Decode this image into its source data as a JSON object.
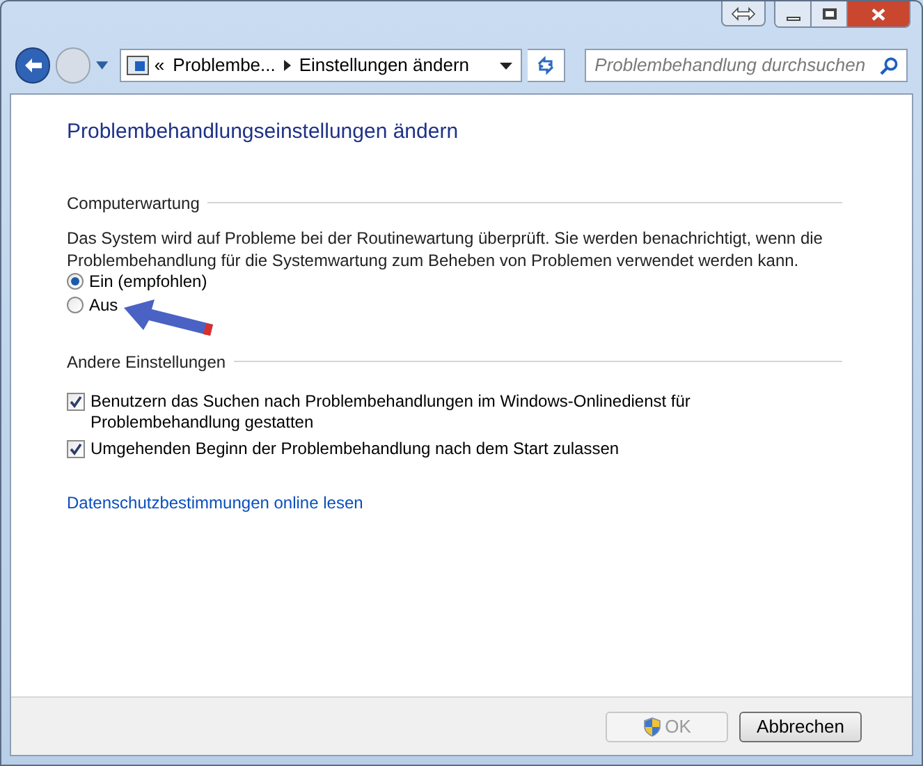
{
  "address_bar": {
    "overflow": "«",
    "crumbs": [
      "Problembe...",
      "Einstellungen ändern"
    ]
  },
  "search": {
    "placeholder": "Problembehandlung durchsuchen"
  },
  "title": "Problembehandlungseinstellungen ändern",
  "sections": [
    {
      "heading": "Computerwartung",
      "description": "Das System wird auf Probleme bei der Routinewartung überprüft. Sie werden benachrichtigt, wenn die Problembehandlung für die Systemwartung zum Beheben von Problemen verwendet werden kann.",
      "options": [
        {
          "kind": "radio",
          "label": "Ein (empfohlen)",
          "selected": true
        },
        {
          "kind": "radio",
          "label": "Aus",
          "selected": false
        }
      ]
    },
    {
      "heading": "Andere Einstellungen",
      "options": [
        {
          "kind": "checkbox",
          "label": "Benutzern das Suchen nach Problembehandlungen im Windows-Onlinedienst für Problembehandlung gestatten",
          "checked": true
        },
        {
          "kind": "checkbox",
          "label": "Umgehenden Beginn der Problembehandlung nach dem Start zulassen",
          "checked": true
        }
      ]
    }
  ],
  "link": "Datenschutzbestimmungen online lesen",
  "buttons": [
    {
      "label": "OK",
      "disabled": true,
      "shield": true
    },
    {
      "label": "Abbrechen",
      "disabled": false,
      "shield": false
    }
  ]
}
